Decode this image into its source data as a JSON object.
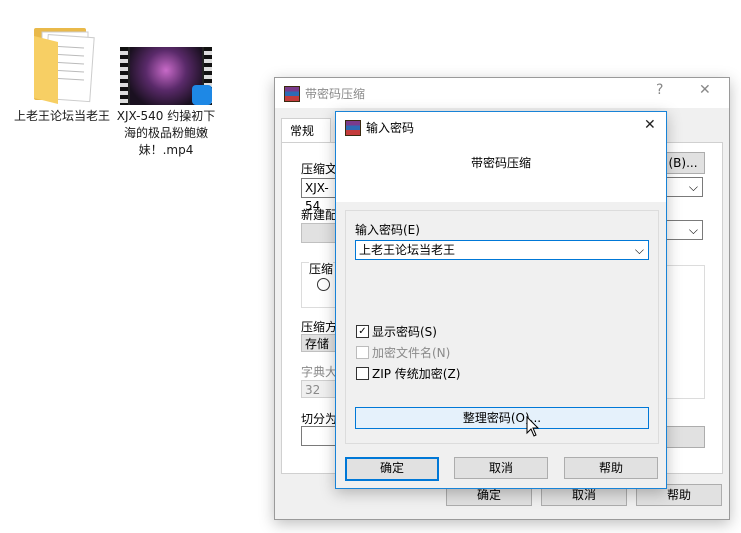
{
  "desktop": {
    "folder_label": "上老王论坛当老王",
    "video_label": "XJX-540 约操初下海的极品粉鲍嫩妹！.mp4"
  },
  "back_dialog": {
    "title": "带密码压缩",
    "help_glyph": "?",
    "close_glyph": "✕",
    "tab_general": "常规",
    "archive_name_label": "压缩文",
    "archive_name_value": "XJX-54",
    "browse_label": "(B)...",
    "new_profile_label": "新建配",
    "format_label": "压缩",
    "method_label": "压缩方",
    "method_value": "存储",
    "dict_label": "字典大",
    "dict_value": "32",
    "split_label": "切分为",
    "ok": "确定",
    "cancel": "取消",
    "help": "帮助"
  },
  "password_dialog": {
    "title": "输入密码",
    "close_glyph": "✕",
    "subtitle": "带密码压缩",
    "password_label": "输入密码(E)",
    "password_value": "上老王论坛当老王",
    "show_password": "显示密码(S)",
    "encrypt_names": "加密文件名(N)",
    "zip_legacy": "ZIP 传统加密(Z)",
    "organize": "整理密码(O)...",
    "ok": "确定",
    "cancel": "取消",
    "help": "帮助",
    "show_password_checked": true,
    "encrypt_names_checked": false,
    "zip_legacy_checked": false
  },
  "colors": {
    "accent": "#0078d7",
    "folder": "#f5c34d"
  }
}
